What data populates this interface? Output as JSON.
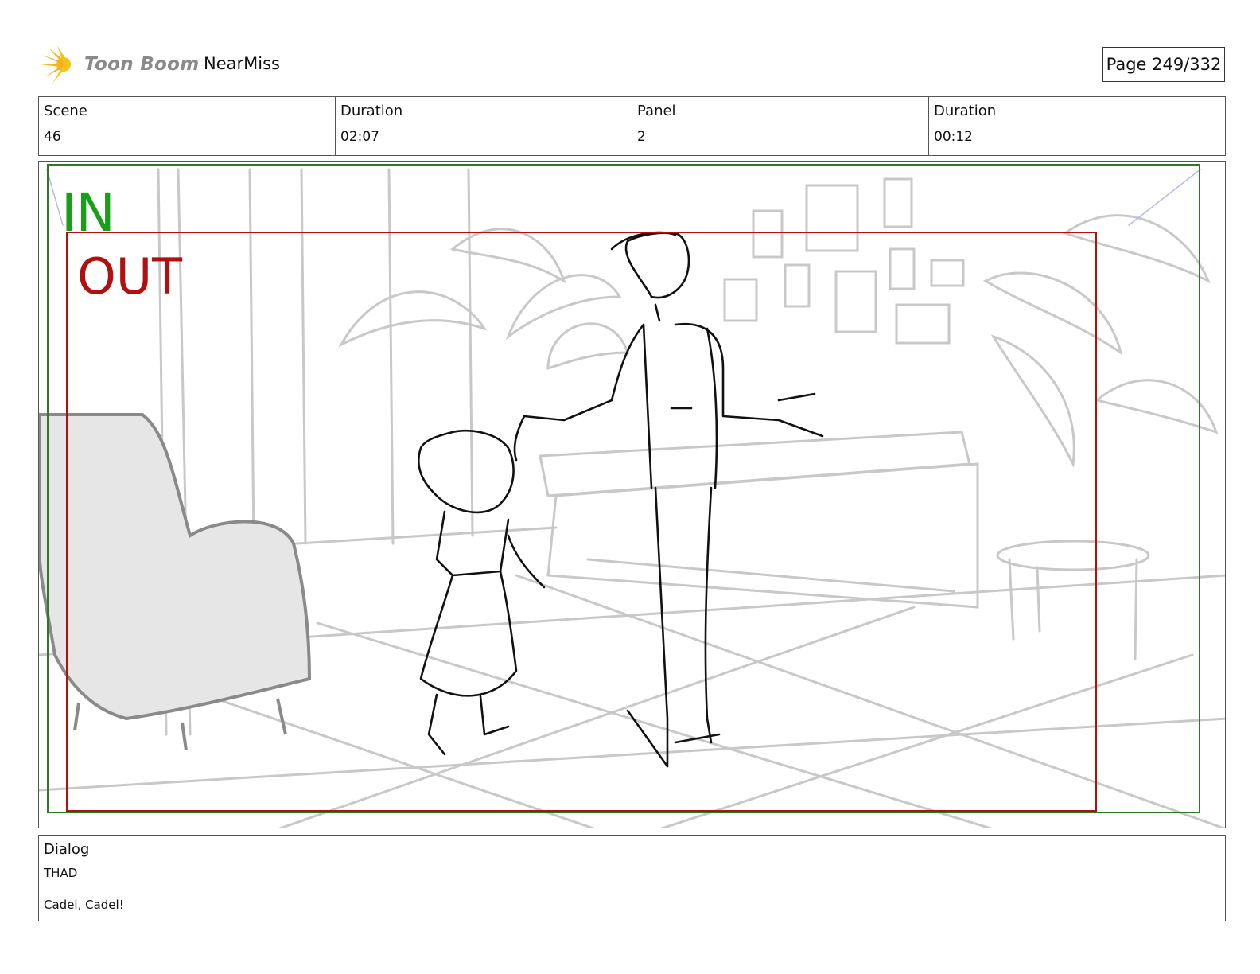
{
  "header": {
    "brand": "Toon Boom",
    "project": "NearMiss",
    "page": "Page 249/332"
  },
  "info": {
    "scene_label": "Scene",
    "scene_value": "46",
    "scene_duration_label": "Duration",
    "scene_duration_value": "02:07",
    "panel_label": "Panel",
    "panel_value": "2",
    "panel_duration_label": "Duration",
    "panel_duration_value": "00:12"
  },
  "frame": {
    "in_label": "IN",
    "out_label": "OUT",
    "in_color": "#1a9e1a",
    "out_color": "#b01010"
  },
  "dialog": {
    "label": "Dialog",
    "speaker": "THAD",
    "line": "Cadel, Cadel!"
  }
}
